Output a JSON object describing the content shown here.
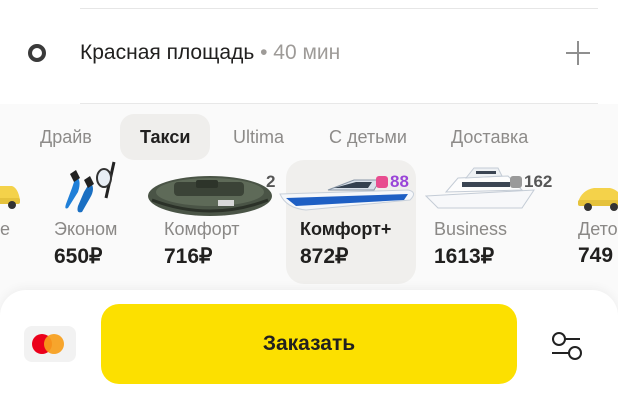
{
  "route": {
    "destination": "Красная площадь",
    "separator": " • ",
    "eta": "40 мин"
  },
  "tabs": [
    {
      "label": "Драйв",
      "active": false
    },
    {
      "label": "Такси",
      "active": true
    },
    {
      "label": "Ultima",
      "active": false
    },
    {
      "label": "С детьми",
      "active": false
    },
    {
      "label": "Доставка",
      "active": false
    }
  ],
  "tariffs": [
    {
      "name": "е",
      "price": "",
      "image": "taxi-car",
      "badge": ""
    },
    {
      "name": "Эконом",
      "price": "650₽",
      "image": "snorkel-flippers",
      "badge": ""
    },
    {
      "name": "Комфорт",
      "price": "716₽",
      "image": "inflatable-boat",
      "badge": "2"
    },
    {
      "name": "Комфорт+",
      "price": "872₽",
      "image": "speedboat",
      "badge": "88",
      "selected": true
    },
    {
      "name": "Business",
      "price": "1613₽",
      "image": "yacht",
      "badge": "162"
    },
    {
      "name": "Дето",
      "price": "749",
      "image": "taxi-car",
      "badge": ""
    }
  ],
  "order": {
    "button_label": "Заказать"
  },
  "icons": {
    "payment": "mastercard-icon",
    "add_stop": "plus-icon",
    "filters": "settings-sliders-icon"
  },
  "colors": {
    "accent": "#fce000",
    "selected_bg": "#f0efed",
    "mastercard_red": "#eb001b",
    "mastercard_orange": "#f79e1b",
    "badge_pink": "#e84d8f"
  }
}
